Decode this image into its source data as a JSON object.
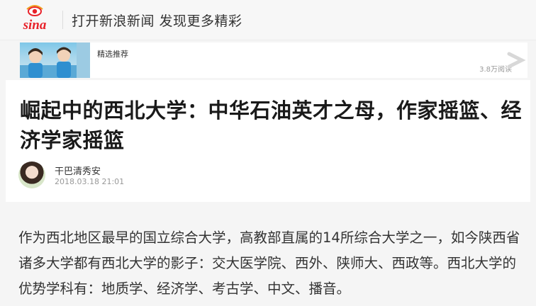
{
  "header": {
    "logo_text": "sina",
    "slogan": "打开新浪新闻 发现更多精彩"
  },
  "recommend": {
    "label": "精选推荐",
    "views": "3.8万阅读"
  },
  "article": {
    "title": "崛起中的西北大学：中华石油英才之母，作家摇篮、经济学家摇篮",
    "author": "干巴清秀安",
    "date": "2018.03.18 21:01",
    "body": "作为西北地区最早的国立综合大学，高教部直属的14所综合大学之一，如今陕西省诸多大学都有西北大学的影子：交大医学院、西外、陕师大、西政等。西北大学的优势学科有：地质学、经济学、考古学、中文、播音。"
  },
  "colors": {
    "brand_red": "#e8222a",
    "title": "#1a1a1a",
    "muted": "#999999"
  }
}
